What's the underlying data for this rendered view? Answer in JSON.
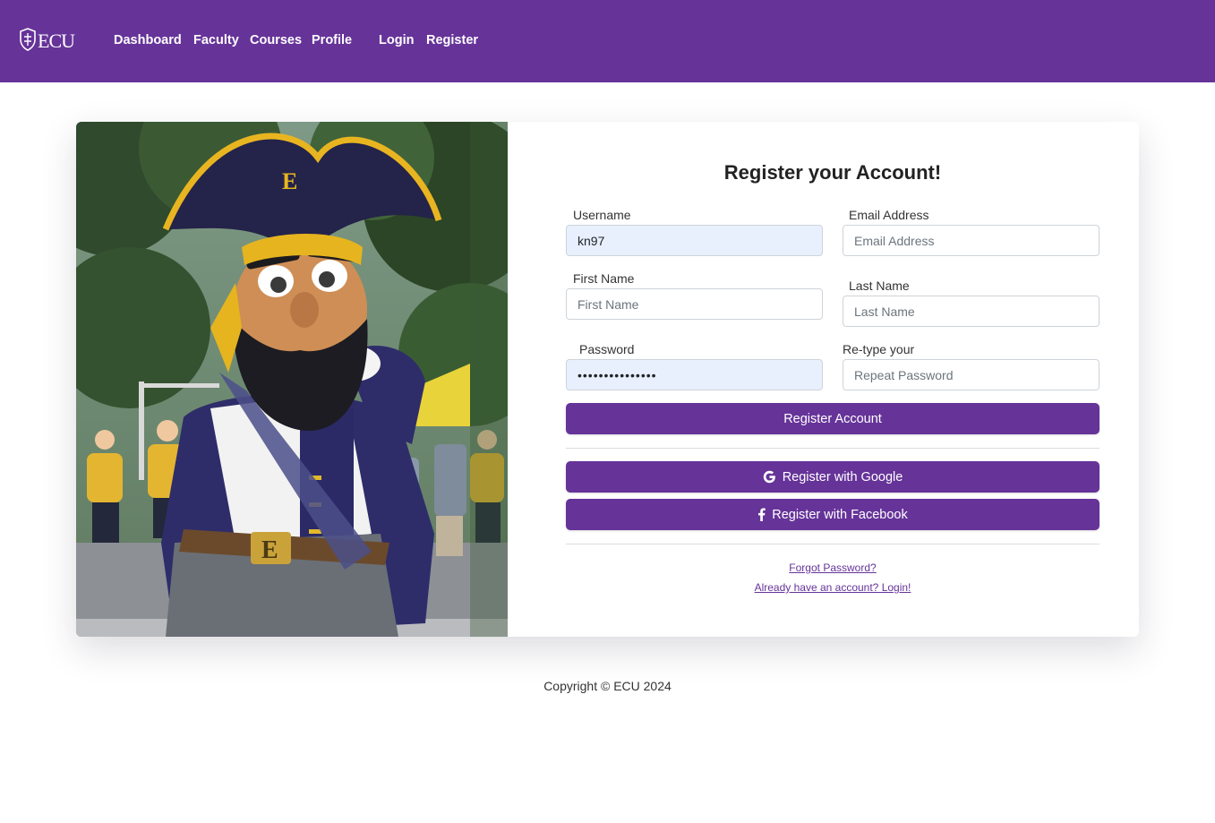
{
  "nav": {
    "brand": "ECU",
    "links": [
      "Dashboard",
      "Faculty",
      "Courses",
      "Profile",
      "Login",
      "Register"
    ]
  },
  "form": {
    "title": "Register your Account!",
    "username": {
      "label": "Username",
      "value": "kn97"
    },
    "email": {
      "label": "Email Address",
      "placeholder": "Email Address"
    },
    "first_name": {
      "label": "First Name",
      "placeholder": "First Name"
    },
    "last_name": {
      "label": "Last Name",
      "placeholder": "Last Name"
    },
    "password": {
      "label": "Password",
      "value": "•••••••••••••••"
    },
    "repeat_password": {
      "label": "Re-type your",
      "placeholder": "Repeat Password"
    },
    "register_button": "Register Account",
    "google_button": "Register with Google",
    "facebook_button": "Register with Facebook",
    "forgot_link": "Forgot Password?",
    "login_link": "Already have an account? Login!"
  },
  "footer": {
    "copyright": "Copyright © ECU 2024"
  },
  "icons": {
    "brand": "ecu-crest-icon",
    "google": "google-icon",
    "facebook": "facebook-icon"
  },
  "colors": {
    "brand": "#663399",
    "autofill": "#e8f0fe",
    "gold": "#f2b81e"
  }
}
